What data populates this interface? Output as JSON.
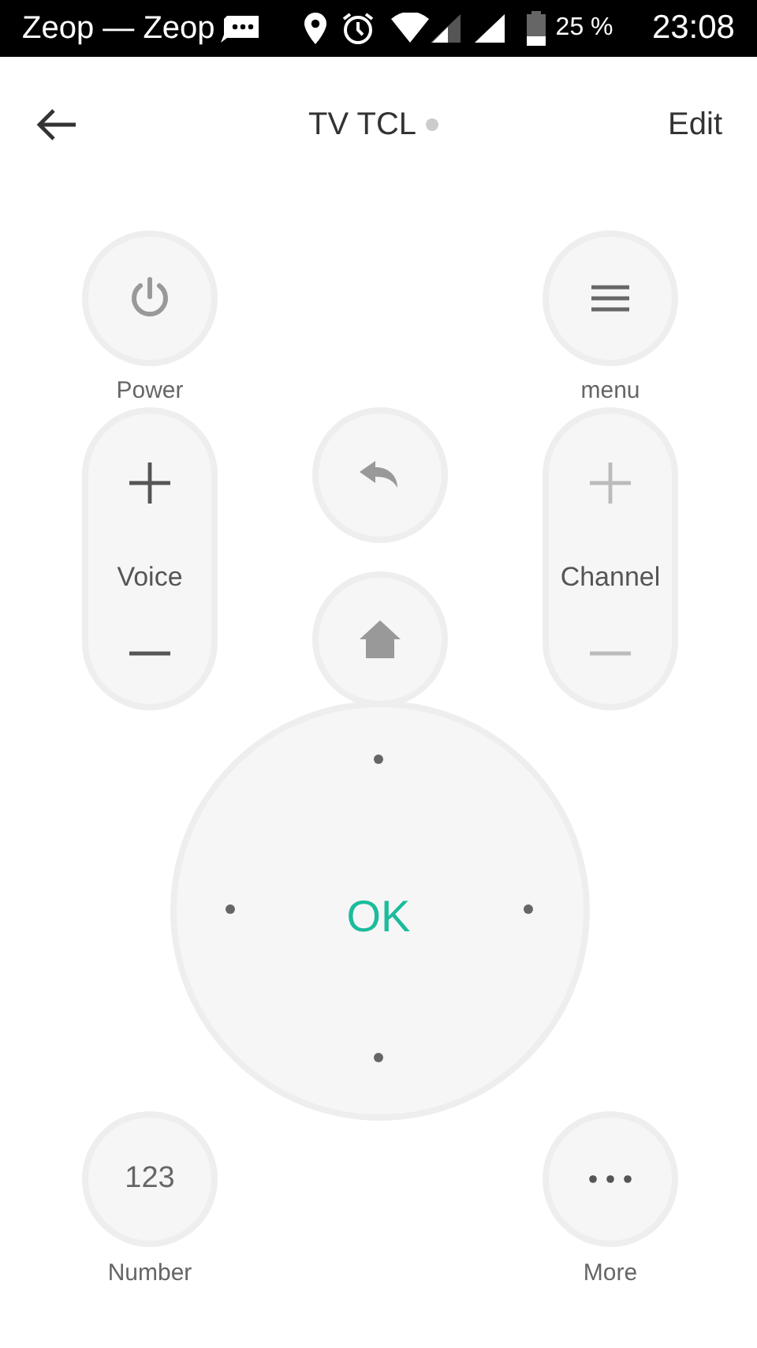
{
  "status_bar": {
    "carrier": "Zeop — Zeop",
    "battery": "25 %",
    "time": "23:08"
  },
  "header": {
    "title": "TV TCL",
    "action": "Edit"
  },
  "top_buttons": [
    {
      "kind": "power",
      "label": "Power"
    },
    {
      "kind": "menu",
      "label": "menu"
    }
  ],
  "rockers": [
    {
      "label": "Voice",
      "disabled": false
    },
    {
      "label": "Channel",
      "disabled": true
    }
  ],
  "dpad": {
    "label": "OK"
  },
  "bottom_buttons": [
    {
      "kind": "number",
      "text": "123",
      "label": "Number"
    },
    {
      "kind": "more",
      "label": "More"
    }
  ]
}
